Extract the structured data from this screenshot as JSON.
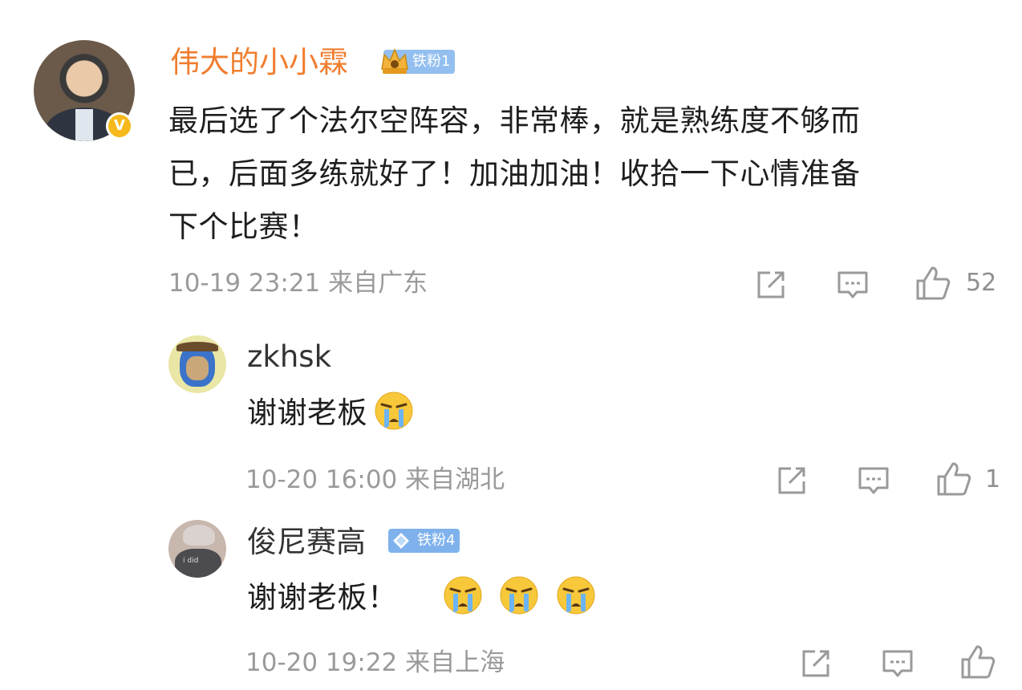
{
  "comments": [
    {
      "name": "伟大的小小霖",
      "badge": "铁粉1",
      "verified_mark": "V",
      "text": "最后选了个法尔空阵容，非常棒，就是熟练度不够而已，后面多练就好了！加油加油！收拾一下心情准备下个比赛！",
      "line1": "最后选了个法尔空阵容，非常棒，就是熟练度不够而",
      "line2": "已，后面多练就好了！加油加油！收拾一下心情准备",
      "line3": "下个比赛！",
      "time": "10-19 23:21 来自广东",
      "likes": "52"
    }
  ],
  "replies": [
    {
      "name": "zkhsk",
      "text": "谢谢老板",
      "emoji_count": 1,
      "emoji": "crying-face",
      "time": "10-20 16:00 来自湖北",
      "likes": "1"
    },
    {
      "name": "俊尼赛高",
      "badge": "铁粉4",
      "avatar_text": "i did",
      "text": "谢谢老板！",
      "emoji_count": 3,
      "emoji": "crying-face",
      "time": "10-20 19:22 来自上海",
      "likes": ""
    }
  ],
  "colors": {
    "vip_name": "#f07d2e",
    "meta": "#9a9a9a",
    "fan_badge": "#7fb2ec",
    "verified": "#f6b91b"
  },
  "icons": [
    "share-icon",
    "comment-icon",
    "like-icon",
    "crying-face-emoji",
    "crown-icon",
    "diamond-icon"
  ]
}
